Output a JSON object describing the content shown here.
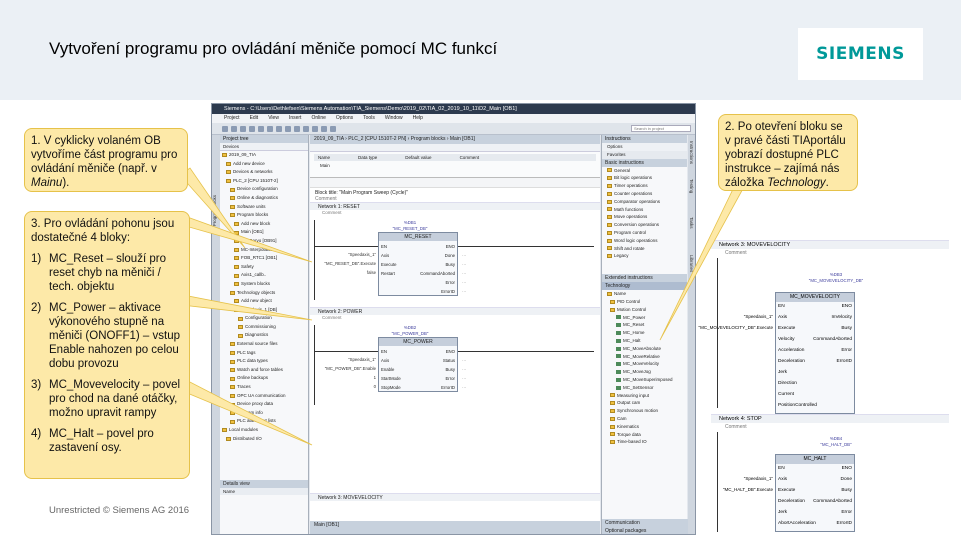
{
  "slide": {
    "title": "Vytvoření programu pro ovládání měniče pomocí MC funkcí",
    "logo": "SIEMENS",
    "footer": "Unrestricted © Siemens AG 2016"
  },
  "callouts": {
    "c1_main": "1. V cyklicky volaném OB vytvoříme část programu pro ovládání měniče (např. v ",
    "c1_em": "Mainu",
    "c1_end": ").",
    "c2_main": "2. Po otevření bloku se v pravé části TIAportálu yobrazí dostupné PLC instrukce – zajímá nás záložka ",
    "c2_em": "Technology",
    "c2_end": ".",
    "c3_head": "3. Pro ovládání pohonu jsou dostatečné 4 bloky:",
    "items": [
      {
        "num": "1)",
        "text": "MC_Reset – slouží pro reset chyb na měniči / tech. objektu"
      },
      {
        "num": "2)",
        "text": "MC_Power – aktivace výkonového stupně na měniči (ONOFF1) – vstup Enable nahozen po celou dobu provozu"
      },
      {
        "num": "3)",
        "text": "MC_Movevelocity – povel pro chod na dané otáčky, možno upravit rampy"
      },
      {
        "num": "4)",
        "text": "MC_Halt – povel pro zastavení osy."
      }
    ]
  },
  "tia": {
    "titlebar": "Siemens - C:\\Users\\Dethlefsen\\Siemens Automation\\TIA_Siemens\\Demo\\2019_02\\TIA_02_2019_10_11\\D2_Main [OB1]",
    "menu": [
      "Project",
      "Edit",
      "View",
      "Insert",
      "Online",
      "Options",
      "Tools",
      "Window",
      "Help"
    ],
    "search_placeholder": "Search in project",
    "left_tab": "Program blocks",
    "project_tree": {
      "header": "Project tree",
      "devices": "Devices",
      "rows": [
        "2019_09_TIA",
        "Add new device",
        "Devices & networks",
        "PLC_2 [CPU 1510T-2]",
        "Device configuration",
        "Online & diagnostics",
        "Software units",
        "Program blocks",
        "Add new block",
        "Main [OB1]",
        "MC-Servo [OB91]",
        "MC-Interpolator",
        "FOB_RTC1 [OB1]",
        "Safety",
        "Axis1_callb..",
        "System blocks",
        "Technology objects",
        "Add new object",
        "Speedaxis_1 [DB]",
        "Configuration",
        "Commissioning",
        "Diagnostics",
        "External source files",
        "PLC tags",
        "PLC data types",
        "Watch and force tables",
        "Online backups",
        "Traces",
        "OPC UA communication",
        "Device proxy data",
        "Program info",
        "PLC alarm text lists",
        "Local modules",
        "Distributed I/O"
      ],
      "details_header": "Details view",
      "details_col": "Name"
    },
    "editor": {
      "tab": "2019_09_TIA › PLC_2 [CPU 1510T-2 PN] › Program blocks › Main [OB1]",
      "interface_label": "Main",
      "interface_cols": [
        "Name",
        "Data type",
        "Default value",
        "Comment"
      ],
      "block_title": "Block title: \"Main Program Sweep (Cycle)\"",
      "block_comment": "Comment",
      "networks": [
        {
          "header": "Network 1: RESET",
          "comment": "Comment",
          "instance_db": "%DB1",
          "instance_name": "\"MC_RESET_DB\"",
          "fb_name": "MC_RESET",
          "inputs": [
            "EN",
            "Axis",
            "Execute",
            "Restart"
          ],
          "input_tags": [
            "",
            "\"Speedaxis_1\"",
            "\"MC_RESET_DB\".Execute",
            "false"
          ],
          "outputs": [
            "ENO",
            "Done",
            "Busy",
            "CommandAborted",
            "Error",
            "ErrorID"
          ],
          "output_tags": [
            "",
            "…",
            "…",
            "…",
            "…",
            "…"
          ]
        },
        {
          "header": "Network 2: POWER",
          "comment": "Comment",
          "instance_db": "%DB2",
          "instance_name": "\"MC_POWER_DB\"",
          "fb_name": "MC_POWER",
          "inputs": [
            "EN",
            "Axis",
            "Enable",
            "StartMode",
            "StopMode"
          ],
          "input_tags": [
            "",
            "\"Speedaxis_1\"",
            "\"MC_POWER_DB\".Enable",
            "1",
            "0"
          ],
          "outputs": [
            "ENO",
            "Status",
            "Busy",
            "Error",
            "ErrorID"
          ],
          "output_tags": [
            "",
            "…",
            "…",
            "…",
            "…"
          ]
        }
      ],
      "network3_header": "Network 3: MOVEVELOCITY",
      "bottom_tab": "Main [OB1]"
    },
    "instructions": {
      "header": "Instructions",
      "options": "Options",
      "favorites": "Favorites",
      "basic_header": "Basic instructions",
      "basic": [
        "General",
        "Bit logic operations",
        "Timer operations",
        "Counter operations",
        "Comparator operations",
        "Math functions",
        "Move operations",
        "Conversion operations",
        "Program control",
        "Word logic operations",
        "Shift and rotate",
        "Legacy"
      ],
      "ext_header": "Extended instructions",
      "tech_header": "Technology",
      "tech": [
        "Name",
        "PID Control",
        "Motion Control",
        "MC_Power",
        "MC_Reset",
        "MC_Home",
        "MC_Halt",
        "MC_MoveAbsolute",
        "MC_MoveRelative",
        "MC_MoveVelocity",
        "MC_MoveJog",
        "MC_MoveSuperimposed",
        "MC_SetSensor",
        "Measuring input",
        "Output cam",
        "Synchronous motion",
        "Cam",
        "Kinematics",
        "Torque data",
        "Time-based IO"
      ],
      "comm_header": "Communication",
      "opt_header": "Optional packages",
      "right_tabs": [
        "Instructions",
        "Testing",
        "Tasks",
        "Libraries"
      ]
    }
  },
  "zoom": {
    "network3": "Network 3: MOVEVELOCITY",
    "comment": "Comment",
    "mv_db": "%DB3",
    "mv_inst": "\"MC_MOVEVELOCITY_DB\"",
    "mv_fb": "MC_MOVEVELOCITY",
    "mv_inputs": [
      "EN",
      "Axis",
      "Execute",
      "Velocity",
      "Acceleration",
      "Deceleration",
      "Jerk",
      "Direction",
      "Current",
      "PositionControlled"
    ],
    "mv_tags": [
      "",
      "\"Speedaxis_1\"",
      "\"MC_MOVEVELOCITY_DB\".Execute",
      "",
      "",
      "",
      "",
      "",
      "",
      ""
    ],
    "mv_outputs": [
      "ENO",
      "InVelocity",
      "Busy",
      "CommandAborted",
      "Error",
      "ErrorID"
    ],
    "network4": "Network 4: STOP",
    "comment4": "Comment",
    "halt_db": "%DB4",
    "halt_inst": "\"MC_HALT_DB\"",
    "halt_fb": "MC_HALT",
    "halt_inputs": [
      "EN",
      "Axis",
      "Execute",
      "Deceleration",
      "Jerk",
      "AbortAcceleration"
    ],
    "halt_tags": [
      "",
      "\"Speedaxis_1\"",
      "\"MC_HALT_DB\".Execute",
      "",
      "",
      ""
    ],
    "halt_outputs": [
      "ENO",
      "Done",
      "Busy",
      "CommandAborted",
      "Error",
      "ErrorID"
    ]
  },
  "colors": {
    "accent": "#009999",
    "callout_bg": "#fde9a8",
    "callout_border": "#e6c24a",
    "header_bg": "#ebf0f5"
  }
}
